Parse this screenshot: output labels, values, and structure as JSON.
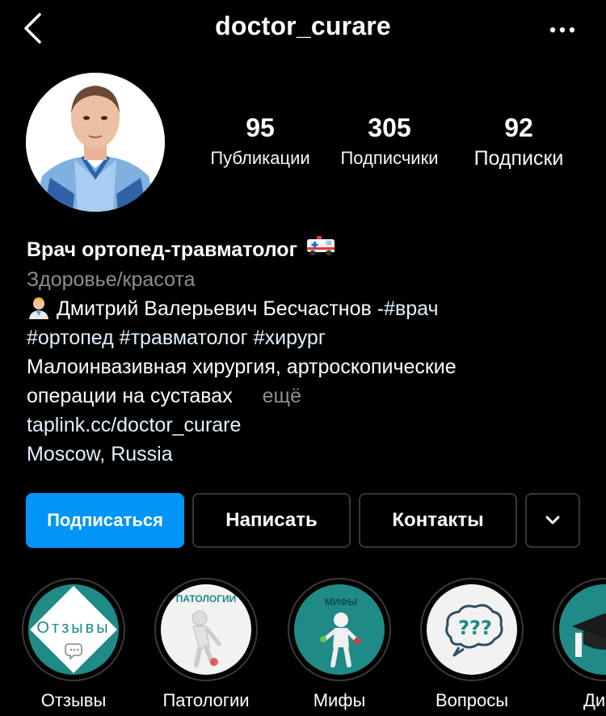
{
  "header": {
    "username": "doctor_curare",
    "back_icon": "chevron-left-icon",
    "more_icon": "more-dots-icon"
  },
  "stats": {
    "posts": {
      "value": "95",
      "label": "Публикации"
    },
    "followers": {
      "value": "305",
      "label": "Подписчики"
    },
    "following": {
      "value": "92",
      "label": "Подписки"
    }
  },
  "bio": {
    "name": "Врач ортопед-травматолог",
    "name_emoji": "🚑",
    "category": "Здоровье/красота",
    "line1_emoji": "👨‍⚕️",
    "line1_text": "Дмитрий Валерьевич Бесчастнов -",
    "line1_tag": "#врач",
    "tags": "#ортопед #травматолог #хирург",
    "line3": "Малоинвазивная хирургия, артроскопические",
    "line4": "операции на суставах",
    "more": "ещё",
    "link": "taplink.cc/doctor_curare",
    "location": "Moscow, Russia"
  },
  "buttons": {
    "follow": "Подписаться",
    "message": "Написать",
    "contacts": "Контакты",
    "dropdown_icon": "chevron-down-icon"
  },
  "highlights": [
    {
      "label": "Отзывы",
      "cover_text": "Отзывы"
    },
    {
      "label": "Патологии",
      "cover_text": "ПАТОЛОГИИ"
    },
    {
      "label": "Мифы",
      "cover_text": "МИФЫ"
    },
    {
      "label": "Вопросы",
      "cover_text": "???"
    },
    {
      "label": "Дипл"
    }
  ],
  "colors": {
    "accent": "#0095f6",
    "teal": "#1f8a86",
    "link": "#e0f1ff",
    "muted": "#8e8e8e"
  }
}
